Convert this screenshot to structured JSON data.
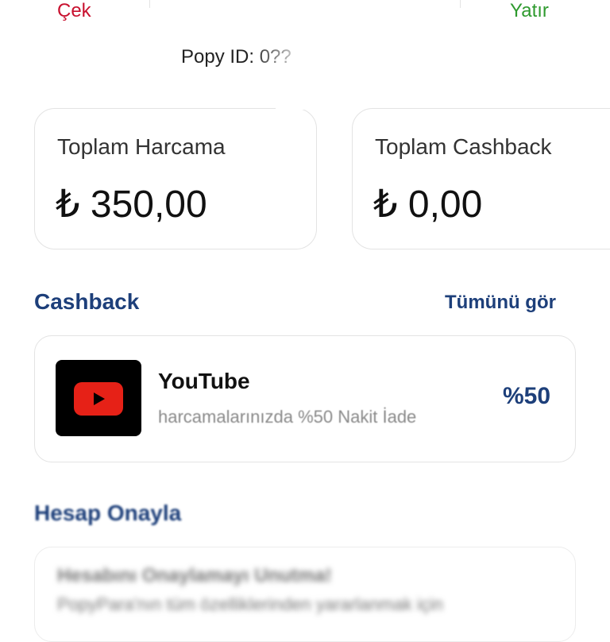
{
  "top_actions": {
    "withdraw_label": "Çek",
    "deposit_label": "Yatır"
  },
  "user": {
    "id_label": "Popy ID: 0??"
  },
  "stats": {
    "total_spend_label": "Toplam Harcama",
    "total_spend_value": "₺ 350,00",
    "total_cashback_label": "Toplam Cashback",
    "total_cashback_value": "₺ 0,00"
  },
  "cashback_section": {
    "title": "Cashback",
    "see_all_label": "Tümünü gör",
    "offers": [
      {
        "name": "YouTube",
        "description": "harcamalarınızda %50 Nakit İade",
        "rate": "%50",
        "icon": "youtube-icon",
        "brand_color": "#e62117"
      }
    ]
  },
  "verify_section": {
    "title": "Hesap Onayla",
    "card_heading": "Hesabını Onaylamayı Unutma!",
    "card_text": "PopyPara'nın tüm özelliklerinden yararlanmak için"
  },
  "colors": {
    "accent": "#1d3f7a",
    "withdraw": "#c8102e",
    "deposit": "#2e9a2e"
  }
}
